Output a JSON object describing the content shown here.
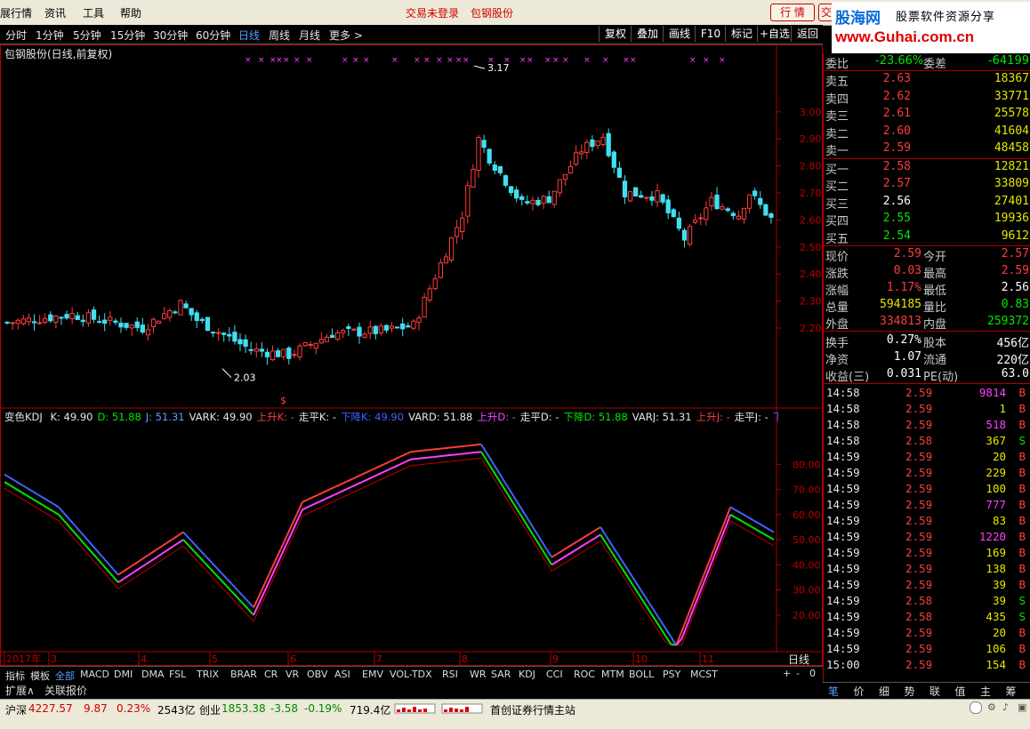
{
  "menu": {
    "items": [
      "展行情",
      "资讯",
      "工具",
      "帮助"
    ],
    "center": "交易未登录",
    "stock": "包钢股份",
    "quote_btn": "行 情",
    "quote_btn2": "交"
  },
  "logo": {
    "brand": "股海网",
    "slogan": "股票软件资源分享",
    "url": "www.Guhai.com.cn"
  },
  "periods": [
    "分时",
    "1分钟",
    "5分钟",
    "15分钟",
    "30分钟",
    "60分钟",
    "日线",
    "周线",
    "月线",
    "更多 >"
  ],
  "active_period": "日线",
  "toolbar": [
    "复权",
    "叠加",
    "画线",
    "F10",
    "标记",
    "+自选",
    "返回"
  ],
  "chart_title": "包钢股份(日线,前复权)",
  "indicator_title": "变色KDJ",
  "indicator_values": [
    {
      "t": "K: 49.90",
      "c": "#e6e6e6"
    },
    {
      "t": "D: 51.88",
      "c": "#00e600"
    },
    {
      "t": "J: 51.31",
      "c": "#5b9bff"
    },
    {
      "t": "VARK: 49.90",
      "c": "#e6e6e6"
    },
    {
      "t": "上升K: -",
      "c": "#ff3c3c"
    },
    {
      "t": "走平K: -",
      "c": "#e6e6e6"
    },
    {
      "t": "下降K: 49.90",
      "c": "#3c64ff"
    },
    {
      "t": "VARD: 51.88",
      "c": "#e6e6e6"
    },
    {
      "t": "上升D: -",
      "c": "#ff40ff"
    },
    {
      "t": "走平D: -",
      "c": "#e6e6e6"
    },
    {
      "t": "下降D: 51.88",
      "c": "#00e600"
    },
    {
      "t": "VARJ: 51.31",
      "c": "#e6e6e6"
    },
    {
      "t": "上升J: -",
      "c": "#ff3c3c"
    },
    {
      "t": "走平J: -",
      "c": "#e6e6e6"
    },
    {
      "t": "下降",
      "c": "#3c64ff"
    }
  ],
  "chart_data": {
    "type": "candlestick",
    "price_axis": [
      "3.00",
      "2.90",
      "2.80",
      "2.70",
      "2.60",
      "2.50",
      "2.40",
      "2.30",
      "2.20"
    ],
    "ind_axis": [
      "80.00",
      "70.00",
      "60.00",
      "50.00",
      "40.00",
      "30.00",
      "20.00"
    ],
    "high_label": "3.17",
    "low_label": "2.03",
    "x_labels": [
      "2017年",
      "3",
      "4",
      "5",
      "6",
      "7",
      "8",
      "9",
      "10",
      "11"
    ],
    "candle_count": 142,
    "close_path": [
      [
        0,
        2.22
      ],
      [
        12,
        2.25
      ],
      [
        25,
        2.2
      ],
      [
        32,
        2.29
      ],
      [
        35,
        2.23
      ],
      [
        45,
        2.12
      ],
      [
        52,
        2.1
      ],
      [
        60,
        2.18
      ],
      [
        70,
        2.19
      ],
      [
        75,
        2.21
      ],
      [
        84,
        2.62
      ],
      [
        87,
        2.9
      ],
      [
        89,
        2.83
      ],
      [
        95,
        2.66
      ],
      [
        100,
        2.68
      ],
      [
        106,
        2.86
      ],
      [
        110,
        2.91
      ],
      [
        114,
        2.7
      ],
      [
        120,
        2.69
      ],
      [
        125,
        2.53
      ],
      [
        130,
        2.67
      ],
      [
        135,
        2.62
      ],
      [
        137,
        2.7
      ],
      [
        142,
        2.58
      ]
    ],
    "k_path": [
      [
        0,
        73
      ],
      [
        10,
        60
      ],
      [
        21,
        33
      ],
      [
        33,
        50
      ],
      [
        46,
        20
      ],
      [
        55,
        62
      ],
      [
        75,
        82
      ],
      [
        88,
        85
      ],
      [
        101,
        40
      ],
      [
        110,
        52
      ],
      [
        124,
        5
      ],
      [
        134,
        60
      ],
      [
        142,
        50
      ]
    ],
    "scale": "y"
  },
  "indicator_tabs": [
    "指标",
    "模板",
    "全部",
    "MACD",
    "DMI",
    "DMA",
    "FSL",
    "TRIX",
    "BRAR",
    "CR",
    "VR",
    "OBV",
    "ASI",
    "EMV",
    "VOL-TDX",
    "RSI",
    "WR",
    "SAR",
    "KDJ",
    "CCI",
    "ROC",
    "MTM",
    "BOLL",
    "PSY",
    "MCST"
  ],
  "ext_tabs": [
    "扩展∧",
    "关联报价"
  ],
  "period_label": "日线",
  "quote": {
    "weibi_label": "委比",
    "weibi": "-23.66%",
    "weicha_label": "委差",
    "weicha": "-64199",
    "sells": [
      {
        "label": "卖五",
        "price": "2.63",
        "vol": "18367"
      },
      {
        "label": "卖四",
        "price": "2.62",
        "vol": "33771"
      },
      {
        "label": "卖三",
        "price": "2.61",
        "vol": "25578"
      },
      {
        "label": "卖二",
        "price": "2.60",
        "vol": "41604"
      },
      {
        "label": "卖一",
        "price": "2.59",
        "vol": "48458"
      }
    ],
    "buys": [
      {
        "label": "买一",
        "price": "2.58",
        "vol": "12821",
        "pc": "red"
      },
      {
        "label": "买二",
        "price": "2.57",
        "vol": "33809",
        "pc": "red"
      },
      {
        "label": "买三",
        "price": "2.56",
        "vol": "27401",
        "pc": "white"
      },
      {
        "label": "买四",
        "price": "2.55",
        "vol": "19936",
        "pc": "green"
      },
      {
        "label": "买五",
        "price": "2.54",
        "vol": "9612",
        "pc": "green"
      }
    ],
    "info": [
      {
        "l1": "现价",
        "v1": "2.59",
        "c1": "red",
        "l2": "今开",
        "v2": "2.57",
        "c2": "red"
      },
      {
        "l1": "涨跌",
        "v1": "0.03",
        "c1": "red",
        "l2": "最高",
        "v2": "2.59",
        "c2": "red"
      },
      {
        "l1": "涨幅",
        "v1": "1.17%",
        "c1": "red",
        "l2": "最低",
        "v2": "2.56",
        "c2": "white"
      },
      {
        "l1": "总量",
        "v1": "594185",
        "c1": "yellow",
        "l2": "量比",
        "v2": "0.83",
        "c2": "green"
      },
      {
        "l1": "外盘",
        "v1": "334813",
        "c1": "red",
        "l2": "内盘",
        "v2": "259372",
        "c2": "green"
      }
    ],
    "info2": [
      {
        "l1": "换手",
        "v1": "0.27%",
        "l2": "股本",
        "v2": "456亿"
      },
      {
        "l1": "净资",
        "v1": "1.07",
        "l2": "流通",
        "v2": "220亿"
      },
      {
        "l1": "收益(三)",
        "v1": "0.031",
        "l2": "PE(动)",
        "v2": "63.0"
      }
    ]
  },
  "ticks": [
    {
      "t": "14:58",
      "p": "2.59",
      "v": "9814",
      "f": "B",
      "vc": "mag"
    },
    {
      "t": "14:58",
      "p": "2.59",
      "v": "1",
      "f": "B",
      "vc": "yellow"
    },
    {
      "t": "14:58",
      "p": "2.59",
      "v": "518",
      "f": "B",
      "vc": "mag"
    },
    {
      "t": "14:58",
      "p": "2.58",
      "v": "367",
      "f": "S",
      "vc": "yellow"
    },
    {
      "t": "14:59",
      "p": "2.59",
      "v": "20",
      "f": "B",
      "vc": "yellow"
    },
    {
      "t": "14:59",
      "p": "2.59",
      "v": "229",
      "f": "B",
      "vc": "yellow"
    },
    {
      "t": "14:59",
      "p": "2.59",
      "v": "100",
      "f": "B",
      "vc": "yellow"
    },
    {
      "t": "14:59",
      "p": "2.59",
      "v": "777",
      "f": "B",
      "vc": "mag"
    },
    {
      "t": "14:59",
      "p": "2.59",
      "v": "83",
      "f": "B",
      "vc": "yellow"
    },
    {
      "t": "14:59",
      "p": "2.59",
      "v": "1220",
      "f": "B",
      "vc": "mag"
    },
    {
      "t": "14:59",
      "p": "2.59",
      "v": "169",
      "f": "B",
      "vc": "yellow"
    },
    {
      "t": "14:59",
      "p": "2.59",
      "v": "138",
      "f": "B",
      "vc": "yellow"
    },
    {
      "t": "14:59",
      "p": "2.59",
      "v": "39",
      "f": "B",
      "vc": "yellow"
    },
    {
      "t": "14:59",
      "p": "2.58",
      "v": "39",
      "f": "S",
      "vc": "yellow"
    },
    {
      "t": "14:59",
      "p": "2.58",
      "v": "435",
      "f": "S",
      "vc": "yellow"
    },
    {
      "t": "14:59",
      "p": "2.59",
      "v": "20",
      "f": "B",
      "vc": "yellow"
    },
    {
      "t": "14:59",
      "p": "2.59",
      "v": "106",
      "f": "B",
      "vc": "yellow"
    },
    {
      "t": "15:00",
      "p": "2.59",
      "v": "154",
      "f": "B",
      "vc": "yellow"
    }
  ],
  "quote_tabs": [
    "笔",
    "价",
    "细",
    "势",
    "联",
    "值",
    "主",
    "筹"
  ],
  "status": {
    "hs_label": "沪深",
    "hs_val": "4227.57",
    "hs_chg": "9.87",
    "hs_pct": "0.23%",
    "hs_amt": "2543亿",
    "cy_label": "创业",
    "cy_val": "1853.38",
    "cy_chg": "-3.58",
    "cy_pct": "-0.19%",
    "cy_amt": "719.4亿",
    "site": "首创证券行情主站"
  }
}
